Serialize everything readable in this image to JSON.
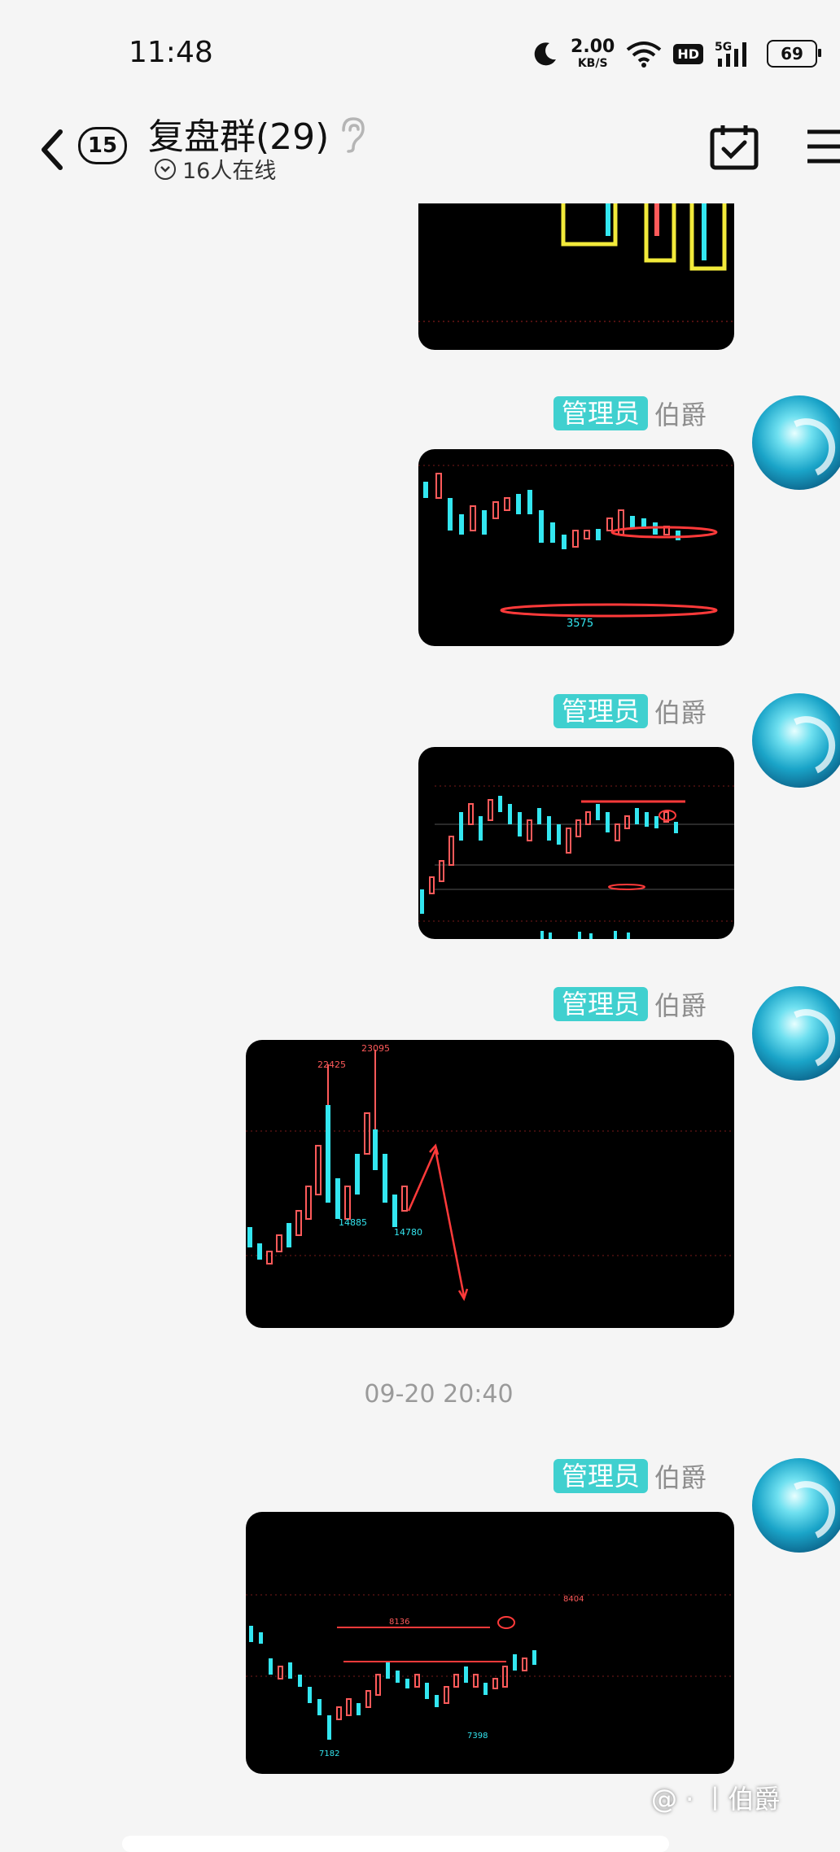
{
  "status_bar": {
    "time": "11:48",
    "net_speed_value": "2.00",
    "net_speed_unit": "KB/S",
    "hd_label": "HD",
    "signal_label": "5G",
    "battery_level": "69"
  },
  "header": {
    "unread_count": "15",
    "title": "复盘群(29)",
    "online_text": "16人在线"
  },
  "messages": [
    {
      "badge": "管理员",
      "sender": "伯爵"
    },
    {
      "badge": "管理员",
      "sender": "伯爵"
    },
    {
      "badge": "管理员",
      "sender": "伯爵"
    },
    {
      "badge": "管理员",
      "sender": "伯爵"
    }
  ],
  "timestamp": "09-20 20:40",
  "chart_labels": {
    "img2_low": "3575",
    "img4_high1": "22425",
    "img4_high2": "23095",
    "img4_low1": "14885",
    "img4_low2": "14780",
    "img5_low1": "7182",
    "img5_low2": "7398",
    "img5_mid": "8136",
    "img5_high": "8404"
  },
  "watermark": "@ · 丨伯爵",
  "colors": {
    "accent_badge": "#40d0cf",
    "candle_up": "#ff5a5a",
    "candle_down": "#33e6f0",
    "highlight_box": "#f2ea3a"
  }
}
